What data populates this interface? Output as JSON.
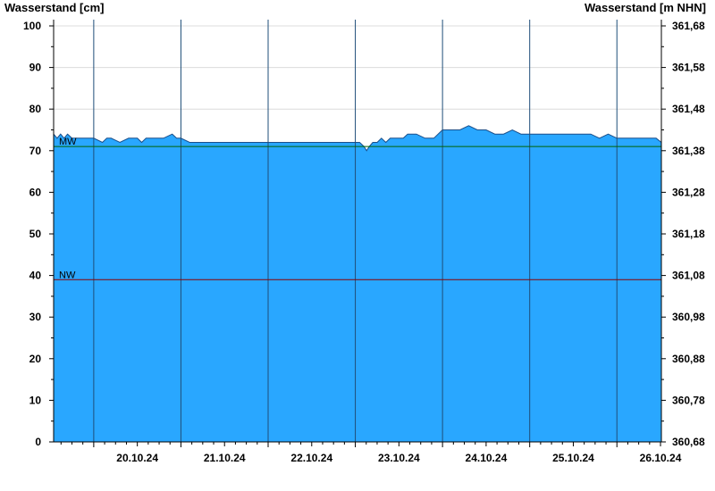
{
  "chart_data": {
    "type": "area",
    "y_left_label": "Wasserstand [cm]",
    "y_right_label": "Wasserstand [m NHN]",
    "y_left_ticks": [
      "0",
      "10",
      "20",
      "30",
      "40",
      "50",
      "60",
      "70",
      "80",
      "90",
      "100"
    ],
    "y_right_ticks": [
      "360,68",
      "360,78",
      "360,88",
      "360,98",
      "361,08",
      "361,18",
      "361,28",
      "361,38",
      "361,48",
      "361,58",
      "361,68"
    ],
    "x_tick_labels": [
      "20.10.24",
      "21.10.24",
      "22.10.24",
      "23.10.24",
      "24.10.24",
      "25.10.24",
      "26.10.24"
    ],
    "ylim": [
      0,
      101.5
    ],
    "xlim_days": [
      19.54,
      26.51
    ],
    "reference_lines": [
      {
        "label": "MW",
        "value": 71,
        "color": "#006400"
      },
      {
        "label": "NW",
        "value": 39,
        "color": "#8b0000"
      }
    ],
    "series": [
      {
        "x": [
          19.54,
          19.58,
          19.62,
          19.66,
          19.7,
          19.75,
          19.8,
          19.9,
          20.0,
          20.1,
          20.15,
          20.2,
          20.3,
          20.4,
          20.5,
          20.55,
          20.6,
          20.7,
          20.8,
          20.9,
          20.95,
          21.0,
          21.1,
          21.2,
          21.3,
          21.4,
          21.5,
          21.6,
          21.7,
          21.8,
          21.9,
          22.0,
          22.1,
          22.2,
          22.3,
          22.4,
          22.5,
          22.6,
          22.7,
          22.8,
          22.9,
          23.0,
          23.05,
          23.1,
          23.13,
          23.16,
          23.2,
          23.25,
          23.3,
          23.35,
          23.4,
          23.45,
          23.5,
          23.55,
          23.6,
          23.7,
          23.8,
          23.9,
          24.0,
          24.1,
          24.2,
          24.3,
          24.4,
          24.5,
          24.6,
          24.7,
          24.8,
          24.9,
          25.0,
          25.1,
          25.2,
          25.3,
          25.4,
          25.5,
          25.6,
          25.7,
          25.8,
          25.9,
          26.0,
          26.1,
          26.2,
          26.3,
          26.4,
          26.45,
          26.51
        ],
        "y": [
          74,
          73,
          74,
          73,
          74,
          73,
          73,
          73,
          73,
          72,
          73,
          73,
          72,
          73,
          73,
          72,
          73,
          73,
          73,
          74,
          73,
          73,
          72,
          72,
          72,
          72,
          72,
          72,
          72,
          72,
          72,
          72,
          72,
          72,
          72,
          72,
          72,
          72,
          72,
          72,
          72,
          72,
          72,
          71,
          70,
          71,
          72,
          72,
          73,
          72,
          73,
          73,
          73,
          73,
          74,
          74,
          73,
          73,
          75,
          75,
          75,
          76,
          75,
          75,
          74,
          74,
          75,
          74,
          74,
          74,
          74,
          74,
          74,
          74,
          74,
          74,
          73,
          74,
          73,
          73,
          73,
          73,
          73,
          73,
          72
        ]
      }
    ],
    "fill_color": "#29a7ff",
    "grid": true
  }
}
